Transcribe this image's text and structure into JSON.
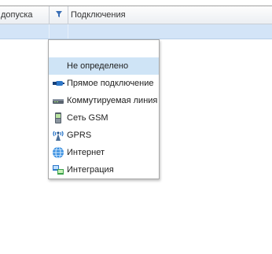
{
  "header": {
    "access_label": "допуска",
    "connections_label": "Подключения"
  },
  "dropdown": {
    "items": [
      {
        "label": "",
        "icon": "blank"
      },
      {
        "label": "Не определено",
        "icon": "blank",
        "selected": true
      },
      {
        "label": "Прямое подключение",
        "icon": "direct-connection-icon"
      },
      {
        "label": "Коммутируемая линия",
        "icon": "modem-icon"
      },
      {
        "label": "Сеть GSM",
        "icon": "mobile-phone-icon"
      },
      {
        "label": "GPRS",
        "icon": "antenna-icon"
      },
      {
        "label": "Интернет",
        "icon": "globe-icon"
      },
      {
        "label": "Интеграция",
        "icon": "integration-icon"
      }
    ]
  },
  "colors": {
    "selection": "#cfe4f6",
    "filter_row": "#d3e4f7"
  }
}
